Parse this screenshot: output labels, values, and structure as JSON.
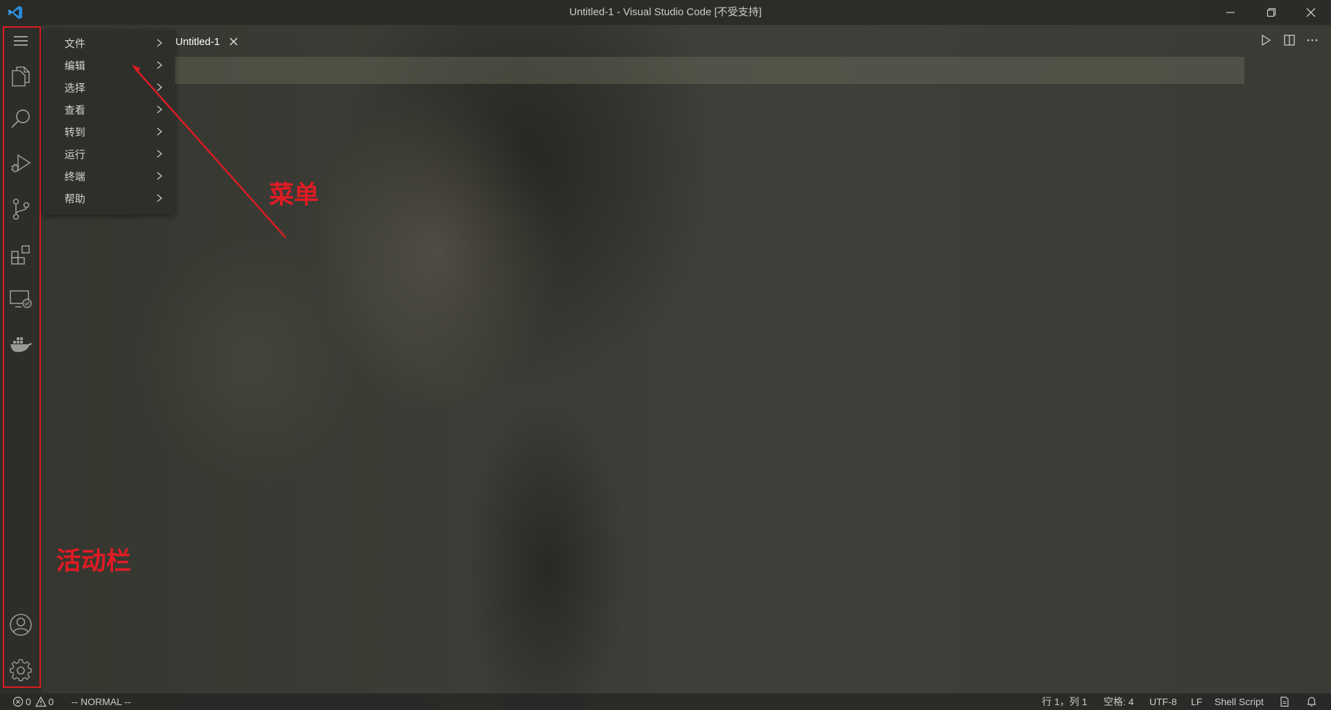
{
  "window": {
    "title": "Untitled-1 - Visual Studio Code [不受支持]"
  },
  "menu": {
    "items": [
      {
        "label": "文件"
      },
      {
        "label": "编辑"
      },
      {
        "label": "选择"
      },
      {
        "label": "查看"
      },
      {
        "label": "转到"
      },
      {
        "label": "运行"
      },
      {
        "label": "终端"
      },
      {
        "label": "帮助"
      }
    ]
  },
  "tabs": [
    {
      "label": "Untitled-1"
    }
  ],
  "activity_bar": {
    "top_icons": [
      "menu-icon",
      "explorer-icon",
      "search-icon",
      "run-debug-icon",
      "source-control-icon",
      "extensions-icon",
      "remote-explorer-icon",
      "docker-icon"
    ],
    "bottom_icons": [
      "account-icon",
      "gear-icon"
    ]
  },
  "annotations": {
    "menu_label": "菜单",
    "activity_bar_label": "活动栏",
    "color": "#e01b24"
  },
  "status_bar": {
    "errors": "0",
    "warnings": "0",
    "vim_mode": "-- NORMAL --",
    "position": "行 1，列 1",
    "indent": "空格: 4",
    "encoding": "UTF-8",
    "eol": "LF",
    "language": "Shell Script"
  }
}
